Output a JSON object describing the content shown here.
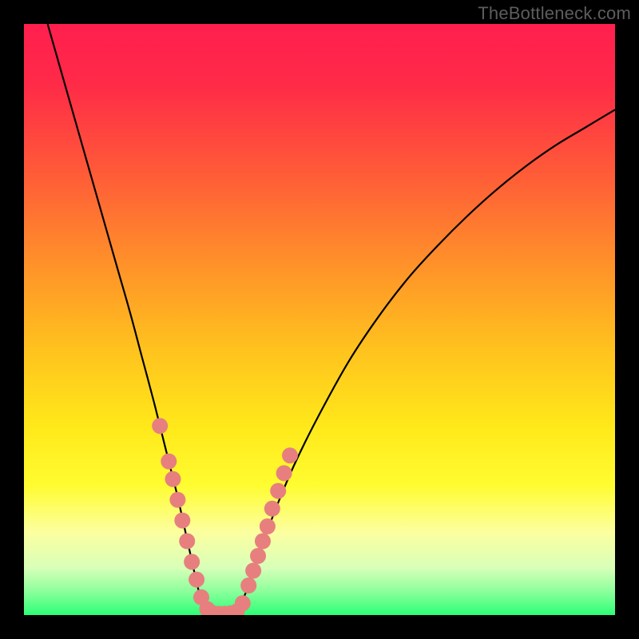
{
  "watermark": "TheBottleneck.com",
  "colors": {
    "frame": "#000000",
    "gradient_stops": [
      {
        "offset": 0.0,
        "color": "#ff1f4f"
      },
      {
        "offset": 0.1,
        "color": "#ff2a48"
      },
      {
        "offset": 0.25,
        "color": "#ff5a38"
      },
      {
        "offset": 0.4,
        "color": "#ff8f2a"
      },
      {
        "offset": 0.55,
        "color": "#ffc21e"
      },
      {
        "offset": 0.68,
        "color": "#ffe81a"
      },
      {
        "offset": 0.78,
        "color": "#fffc30"
      },
      {
        "offset": 0.86,
        "color": "#fcffa0"
      },
      {
        "offset": 0.92,
        "color": "#d8ffb8"
      },
      {
        "offset": 0.96,
        "color": "#8cff9c"
      },
      {
        "offset": 1.0,
        "color": "#2cff76"
      }
    ],
    "curve": "#000000",
    "dot_fill": "#e77f7f",
    "dot_stroke": "#d46a6a"
  },
  "chart_data": {
    "type": "line",
    "title": "",
    "xlabel": "",
    "ylabel": "",
    "xlim": [
      0,
      100
    ],
    "ylim": [
      0,
      100
    ],
    "grid": false,
    "series": [
      {
        "name": "left-branch",
        "x": [
          4,
          6,
          8,
          10,
          12,
          14,
          16,
          18,
          20,
          22,
          24,
          25,
          26,
          27,
          28,
          29,
          30,
          31
        ],
        "y": [
          100,
          93,
          86,
          79,
          72,
          65,
          58,
          51,
          43.5,
          36,
          28,
          24,
          20,
          15.5,
          11,
          6.5,
          2.5,
          0.5
        ]
      },
      {
        "name": "valley",
        "x": [
          31,
          32,
          33,
          34,
          35,
          36
        ],
        "y": [
          0.5,
          0,
          0,
          0,
          0,
          0.5
        ]
      },
      {
        "name": "right-branch",
        "x": [
          36,
          38,
          40,
          43,
          46,
          50,
          55,
          60,
          65,
          70,
          75,
          80,
          85,
          90,
          95,
          100
        ],
        "y": [
          0.5,
          5,
          11,
          19,
          26,
          34,
          43,
          50.5,
          57,
          62.5,
          67.5,
          72,
          76,
          79.5,
          82.5,
          85.5
        ]
      }
    ],
    "dots": {
      "name": "markers",
      "x": [
        23,
        24.5,
        25.2,
        26,
        26.8,
        27.6,
        28.4,
        29.2,
        30,
        31,
        32,
        33,
        34,
        35,
        36,
        37,
        38,
        38.8,
        39.6,
        40.4,
        41.2,
        42,
        43,
        44,
        45
      ],
      "y": [
        32,
        26,
        23,
        19.5,
        16,
        12.5,
        9,
        6,
        3,
        1,
        0.3,
        0.2,
        0.2,
        0.3,
        0.6,
        2,
        5,
        7.5,
        10,
        12.5,
        15,
        18,
        21,
        24,
        27
      ]
    }
  }
}
